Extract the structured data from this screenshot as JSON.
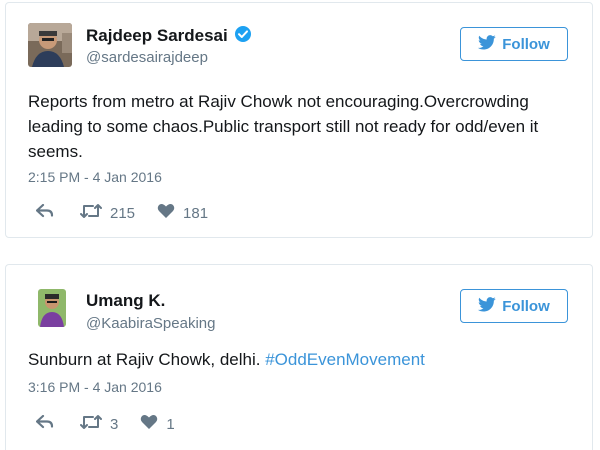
{
  "tweets": [
    {
      "name": "Rajdeep Sardesai",
      "handle": "@sardesairajdeep",
      "verified": true,
      "follow_label": "Follow",
      "text": "Reports from metro at Rajiv Chowk not encouraging.Overcrowding leading to some chaos.Public transport still not ready for odd/even it seems.",
      "timestamp": "2:15 PM - 4 Jan 2016",
      "retweets": "215",
      "likes": "181"
    },
    {
      "name": "Umang K.",
      "handle": "@KaabiraSpeaking",
      "verified": false,
      "follow_label": "Follow",
      "text": "Sunburn at Rajiv Chowk, delhi. ",
      "hashtag": "#OddEvenMovement",
      "timestamp": "3:16 PM - 4 Jan 2016",
      "retweets": "3",
      "likes": "1"
    }
  ],
  "colors": {
    "accent": "#3b94d9",
    "muted": "#657786",
    "text": "#14171a",
    "border": "#e1e8ed"
  },
  "icons": {
    "follow": "twitter-bird-icon",
    "verified": "verified-badge-icon",
    "reply": "reply-icon",
    "retweet": "retweet-icon",
    "like": "heart-icon"
  }
}
